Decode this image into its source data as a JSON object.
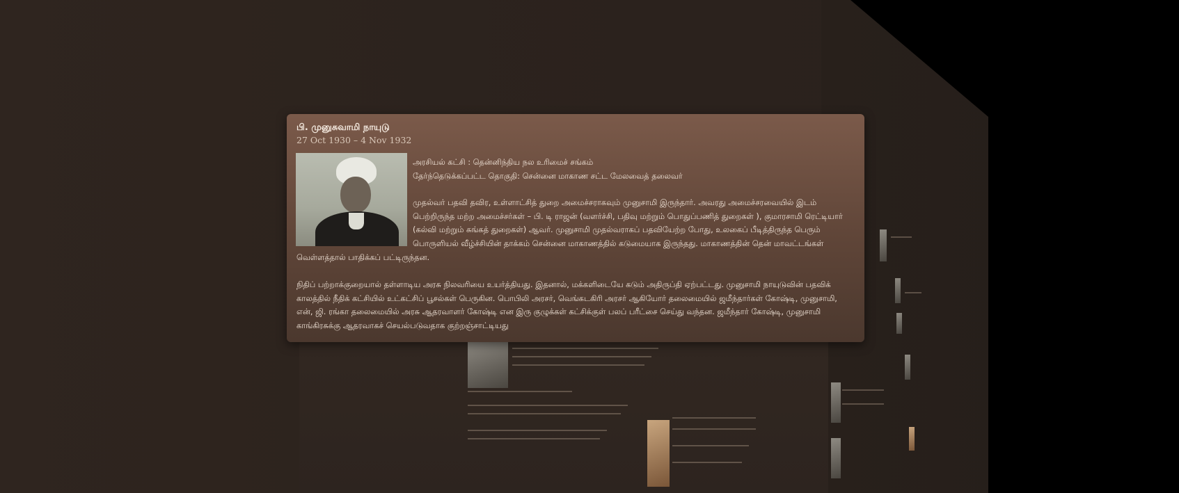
{
  "popup": {
    "title": "பி. முனுசுவாமி நாயுடு",
    "dates": "27 Oct 1930 – 4 Nov 1932",
    "party": "அரசியல் கட்சி : தென்னிந்திய நல உரிமைச் சங்கம்",
    "constituency": "தேர்ந்தெடுக்கப்பட்ட தொகுதி: சென்னை மாகாண சட்ட மேலவைத் தலைவர்",
    "para1_lines": [
      "முதல்வர் பதவி தவிர, உள்ளாட்சித் துறை அமைச்சராகவும் முனுசாமி இருந்தார். அவரது அமைச்சரவையில் இடம்",
      "பெற்றிருந்த மற்ற அமைச்சர்கள் – பி. டி ராஜன் (வளர்ச்சி, பதிவு மற்றும் பொதுப்பணித் துறைகள் ), குமாரசாமி ரெட்டியார்",
      "(கல்வி மற்றும் சுங்கத் துறைகள்) ஆவர். முனுசாமி முதல்வராகப் பதவியேற்ற போது, உலகைப் பீடித்திருந்த பெரும்",
      "பொருளியல் வீழ்ச்சியின் தாக்கம் சென்னை மாகாணத்தில் கடுமையாக இருந்தது. மாகாணத்தின் தென் மாவட்டங்கள்"
    ],
    "para1_tail": "வெள்ளத்தால் பாதிக்கப் பட்டிருந்தன.",
    "para2_lines": [
      "நிதிப் பற்றாக்குறையால் தள்ளாடிய அரசு நிலவரியை உயர்த்தியது. இதனால், மக்களிடையே கடும் அதிருப்தி ஏற்பட்டது. முனுசாமி நாயுடுவின் பதவிக்",
      "காலத்தில் நீதிக் கட்சியில் உட்கட்சிப் பூசல்கள் பெருகின. பொபிலி அரசர், வெங்கடகிரி அரசர் ஆகியோர் தலைமையில் ஜமீந்தார்கள் கோஷ்டி, முனுசாமி,",
      "என், ஜி. ரங்கா தலைமையில் அரசு ஆதரவாளர் கோஷ்டி என இரு குழுக்கள் கட்சிக்குள் பலப் பரீட்சை செய்து வந்தன. ஜமீந்தார் கோஷ்டி, முனுசாமி",
      "காங்கிரசுக்கு ஆதரவாகச் செயல்படுவதாக குற்றஞ்சாட்டியது"
    ]
  },
  "colors": {
    "background": "#2e241f",
    "popup_top": "#7b5a4a",
    "popup_bottom": "#4b382e",
    "text": "#efe2d6"
  }
}
